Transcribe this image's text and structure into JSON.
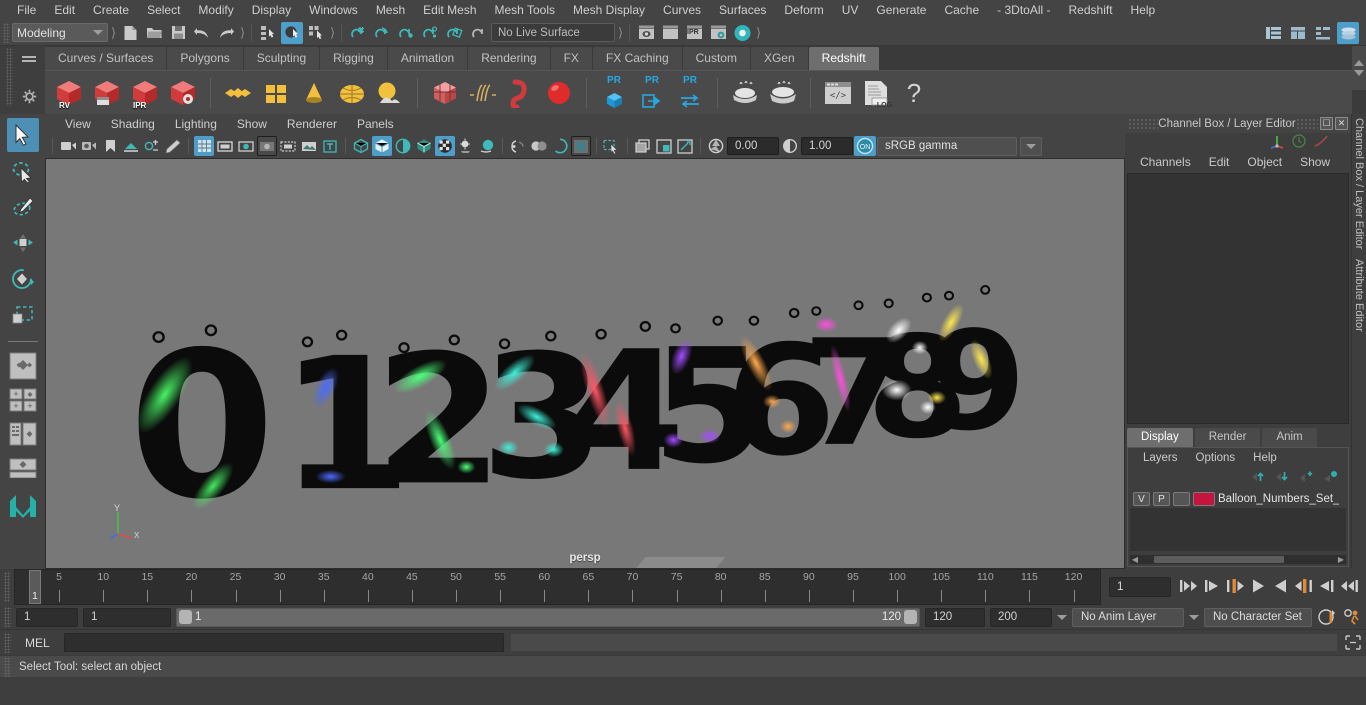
{
  "app": {
    "menus": [
      "File",
      "Edit",
      "Create",
      "Select",
      "Modify",
      "Display",
      "Windows",
      "Mesh",
      "Edit Mesh",
      "Mesh Tools",
      "Mesh Display",
      "Curves",
      "Surfaces",
      "Deform",
      "UV",
      "Generate",
      "Cache",
      "- 3DtoAll -",
      "Redshift",
      "Help"
    ]
  },
  "statusbar": {
    "mode": "Modeling",
    "live_surface": "No Live Surface",
    "icons": [
      "new-scene-icon",
      "open-scene-icon",
      "save-scene-icon",
      "undo-icon",
      "redo-icon",
      "select-by-hierarchy-icon",
      "select-by-object-icon",
      "select-by-component-icon",
      "snap-to-grid-icon",
      "snap-to-curve-icon",
      "snap-to-point-icon",
      "snap-to-projected-center-icon",
      "snap-to-view-plane-icon",
      "make-live-icon",
      "render-view-icon",
      "render-region-icon",
      "ipr-render-icon",
      "render-settings-icon",
      "hypershade-icon",
      "show-attribute-editor-icon",
      "show-tool-settings-icon",
      "show-channel-box-icon",
      "redshift-render-view-icon"
    ]
  },
  "shelf": {
    "tabs": [
      "Curves / Surfaces",
      "Polygons",
      "Sculpting",
      "Rigging",
      "Animation",
      "Rendering",
      "FX",
      "FX Caching",
      "Custom",
      "XGen",
      "Redshift"
    ],
    "selected_tab": "Redshift",
    "buttons": [
      {
        "name": "redshift-render-view",
        "label": "RV"
      },
      {
        "name": "redshift-render-sequence",
        "label": ""
      },
      {
        "name": "redshift-ipr-render",
        "label": "IPR"
      },
      {
        "name": "redshift-render-settings",
        "label": ""
      },
      {
        "name": "redshift-material-icon",
        "label": ""
      },
      {
        "name": "redshift-plane-icon",
        "label": ""
      },
      {
        "name": "redshift-cone-light-icon",
        "label": ""
      },
      {
        "name": "redshift-dome-light-icon",
        "label": ""
      },
      {
        "name": "redshift-environment-icon",
        "label": ""
      },
      {
        "name": "redshift-proxy-icon",
        "label": ""
      },
      {
        "name": "redshift-hair-icon",
        "label": ""
      },
      {
        "name": "redshift-volume-icon",
        "label": ""
      },
      {
        "name": "redshift-sphere-icon",
        "label": ""
      },
      {
        "name": "redshift-pr-object",
        "label": "PR"
      },
      {
        "name": "redshift-pr-export",
        "label": "PR"
      },
      {
        "name": "redshift-pr-swap",
        "label": "PR"
      },
      {
        "name": "redshift-bake-icon",
        "label": ""
      },
      {
        "name": "redshift-bake-all-icon",
        "label": ""
      },
      {
        "name": "redshift-script-icon",
        "label": ""
      },
      {
        "name": "redshift-log-icon",
        "label": ".LOG"
      },
      {
        "name": "redshift-help-icon",
        "label": "?"
      }
    ]
  },
  "toolbox": {
    "tools": [
      "select-tool",
      "lasso-select-tool",
      "paint-select-tool",
      "move-tool",
      "rotate-tool",
      "scale-tool"
    ],
    "layouts": [
      "single-perspective-view-layout",
      "four-view-layout",
      "outliner-persp-layout",
      "hypershade-persp-layout"
    ],
    "selected_tool": "select-tool"
  },
  "viewport": {
    "panel_menus": [
      "View",
      "Shading",
      "Lighting",
      "Show",
      "Renderer",
      "Panels"
    ],
    "camera_label": "persp",
    "exposure": "0.00",
    "gamma_value": "1.00",
    "color_management": "sRGB gamma",
    "color_mgmt_enabled": "ON",
    "balloons": [
      "0",
      "1",
      "2",
      "3",
      "4",
      "5",
      "6",
      "7",
      "8",
      "9"
    ],
    "balloon_colors": [
      "#2bd34a",
      "#2a4fe0",
      "#2ad35a",
      "#21c8b6",
      "#d6404f",
      "#8b2ce0",
      "#e2963a",
      "#d32cc8",
      "#e8e8e8",
      "#e0cc2c"
    ],
    "axis_label_y": "Y",
    "axis_label_x": "X"
  },
  "channel_box": {
    "title": "Channel Box / Layer Editor",
    "menus": [
      "Channels",
      "Edit",
      "Object",
      "Show"
    ],
    "side_tabs": [
      "Channel Box / Layer Editor",
      "Attribute Editor"
    ]
  },
  "layer_editor": {
    "tabs": [
      "Display",
      "Render",
      "Anim"
    ],
    "selected_tab": "Display",
    "menus": [
      "Layers",
      "Options",
      "Help"
    ],
    "icons": [
      "move-layer-up-icon",
      "move-layer-down-icon",
      "create-new-layer-icon",
      "create-layer-from-selected-icon"
    ],
    "layers": [
      {
        "visibility": "V",
        "playback": "P",
        "shading": "",
        "color": "#c4153f",
        "name": "Balloon_Numbers_Set_"
      }
    ]
  },
  "timeline": {
    "current_frame": "1",
    "playhead_label": "1",
    "ticks": [
      5,
      10,
      15,
      20,
      25,
      30,
      35,
      40,
      45,
      50,
      55,
      60,
      65,
      70,
      75,
      80,
      85,
      90,
      95,
      100,
      105,
      110,
      115,
      120
    ],
    "range_start": "1",
    "anim_start": "1",
    "slider_start_label": "1",
    "slider_end_label": "120",
    "range_end": "120",
    "anim_end": "200",
    "anim_layer": "No Anim Layer",
    "character_set": "No Character Set",
    "transport": [
      "go-to-start-icon",
      "step-back-keyframe-icon",
      "step-back-frame-icon",
      "play-backwards-icon",
      "play-forwards-icon",
      "step-forward-frame-icon",
      "step-forward-keyframe-icon",
      "go-to-end-icon"
    ]
  },
  "command_line": {
    "language": "MEL",
    "input_value": "",
    "output_value": ""
  },
  "help_line": {
    "message": "Select Tool: select an object"
  }
}
